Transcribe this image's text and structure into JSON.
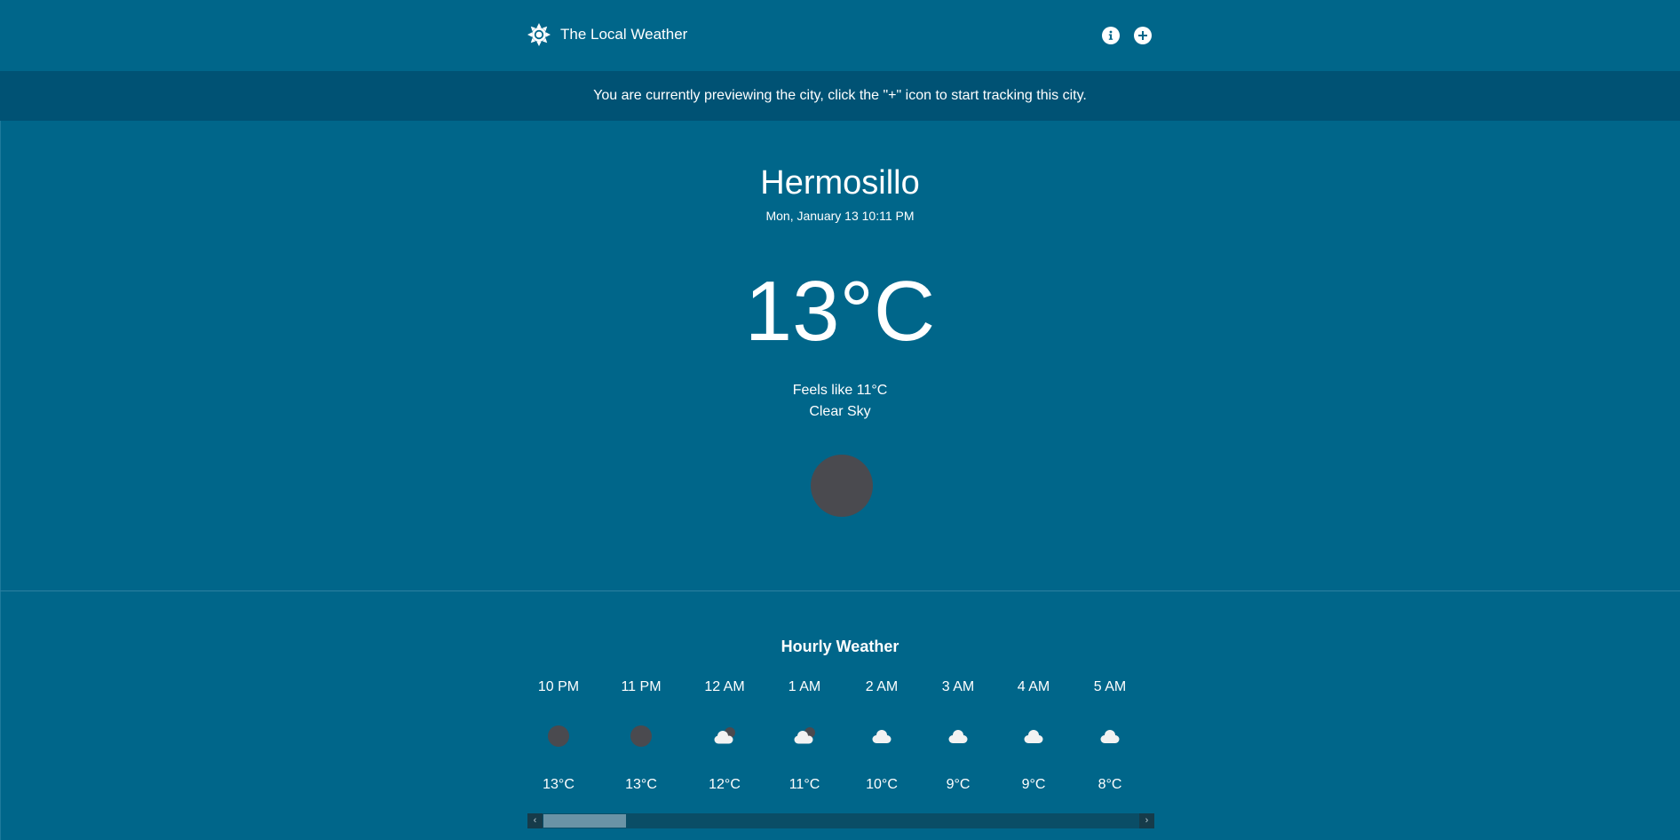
{
  "header": {
    "app_title": "The Local Weather",
    "logo_icon": "sun-gear-icon",
    "info_icon": "info-icon",
    "add_icon": "plus-icon"
  },
  "banner": {
    "text": "You are currently previewing the city, click the \"+\" icon to start tracking this city."
  },
  "current": {
    "city": "Hermosillo",
    "datetime": "Mon, January 13 10:11 PM",
    "temperature": "13°C",
    "feels_like": "Feels like 11°C",
    "description": "Clear Sky",
    "icon": "moon-icon"
  },
  "hourly": {
    "title": "Hourly Weather",
    "items": [
      {
        "time": "10 PM",
        "temp": "13°C",
        "icon": "moon-icon"
      },
      {
        "time": "11 PM",
        "temp": "13°C",
        "icon": "moon-icon"
      },
      {
        "time": "12 AM",
        "temp": "12°C",
        "icon": "cloud-moon-icon"
      },
      {
        "time": "1 AM",
        "temp": "11°C",
        "icon": "cloud-moon-icon"
      },
      {
        "time": "2 AM",
        "temp": "10°C",
        "icon": "cloud-icon"
      },
      {
        "time": "3 AM",
        "temp": "9°C",
        "icon": "cloud-icon"
      },
      {
        "time": "4 AM",
        "temp": "9°C",
        "icon": "cloud-icon"
      },
      {
        "time": "5 AM",
        "temp": "8°C",
        "icon": "cloud-icon"
      }
    ]
  },
  "scrollbar": {
    "left_arrow": "‹",
    "right_arrow": "›"
  },
  "colors": {
    "background": "#00668a",
    "banner": "#005274",
    "moon": "#4a4a4f",
    "cloud": "#f2f2f2"
  }
}
